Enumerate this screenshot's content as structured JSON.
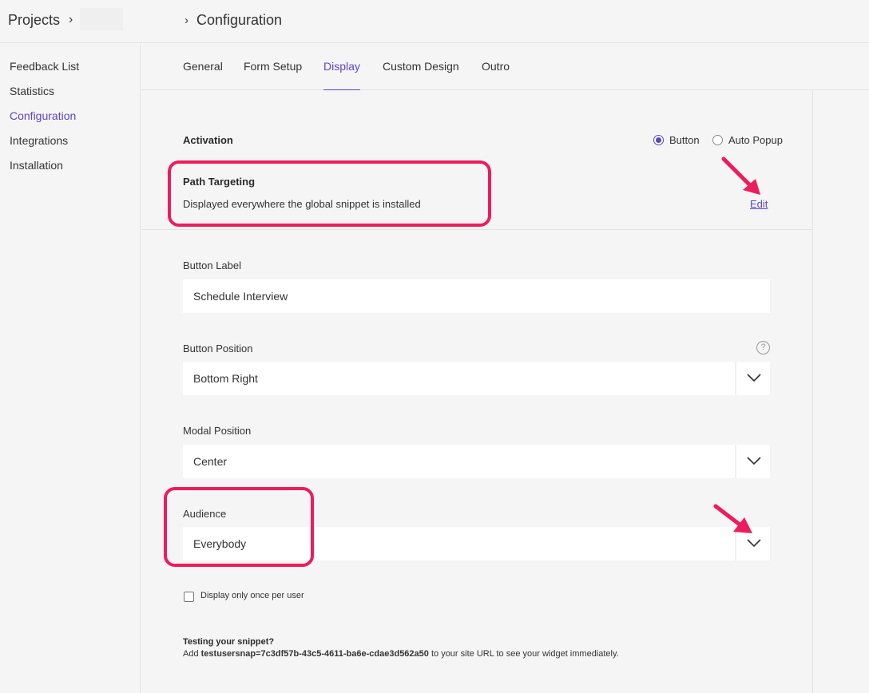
{
  "breadcrumb": {
    "projects": "Projects",
    "sep1": "›",
    "sep2": "›",
    "current": "Configuration"
  },
  "sidebar": {
    "items": [
      {
        "label": "Feedback List"
      },
      {
        "label": "Statistics"
      },
      {
        "label": "Configuration",
        "active": true
      },
      {
        "label": "Integrations"
      },
      {
        "label": "Installation"
      }
    ]
  },
  "tabs": [
    {
      "label": "General"
    },
    {
      "label": "Form Setup"
    },
    {
      "label": "Display",
      "active": true
    },
    {
      "label": "Custom Design"
    },
    {
      "label": "Outro"
    }
  ],
  "activation": {
    "label": "Activation",
    "options": [
      "Button",
      "Auto Popup"
    ],
    "selected": "Button"
  },
  "path_targeting": {
    "title": "Path Targeting",
    "description": "Displayed everywhere the global snippet is installed",
    "edit_label": "Edit"
  },
  "button_label": {
    "label": "Button Label",
    "value": "Schedule Interview"
  },
  "button_position": {
    "label": "Button Position",
    "value": "Bottom Right",
    "help": "?"
  },
  "modal_position": {
    "label": "Modal Position",
    "value": "Center"
  },
  "audience": {
    "label": "Audience",
    "value": "Everybody"
  },
  "display_once": {
    "label": "Display only once per user",
    "checked": false
  },
  "testing": {
    "title": "Testing your snippet?",
    "prefix": "Add ",
    "param": "testusersnap=7c3df57b-43c5-4611-ba6e-cdae3d562a50",
    "suffix": " to your site URL to see your widget immediately."
  },
  "colors": {
    "accent": "#5b45c9",
    "highlight": "#ed1c5c"
  }
}
